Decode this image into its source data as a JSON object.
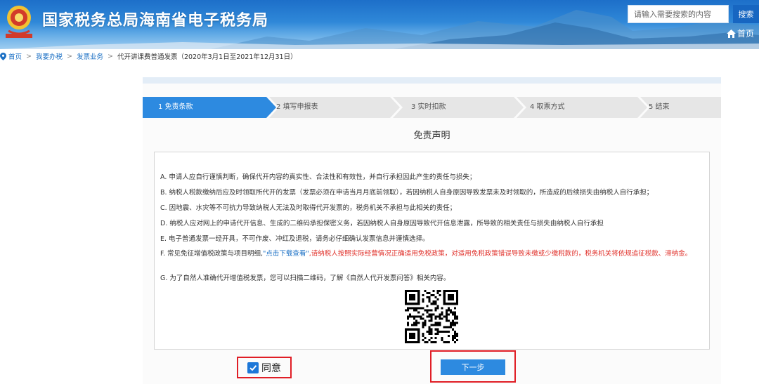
{
  "header": {
    "title": "国家税务总局海南省电子税务局",
    "search_placeholder": "请输入需要搜索的内容",
    "search_button": "搜索",
    "home_label": "首页"
  },
  "breadcrumb": {
    "items": [
      "首页",
      "我要办税",
      "发票业务",
      "代开讲课费普通发票（2020年3月1日至2021年12月31日）"
    ],
    "separator": ">"
  },
  "steps": [
    {
      "label": "1  免责条款",
      "active": true
    },
    {
      "label": "2  填写申报表",
      "active": false
    },
    {
      "label": "3  实时扣款",
      "active": false
    },
    {
      "label": "4  取票方式",
      "active": false
    },
    {
      "label": "5  结束",
      "active": false
    }
  ],
  "notice": {
    "title": "免责声明",
    "terms": {
      "a": "A. 申请人应自行谨慎判断，确保代开内容的真实性、合法性和有效性，并自行承担因此产生的责任与损失；",
      "b": "B. 纳税人税款缴纳后应及时领取所代开的发票（发票必须在申请当月月底前领取），若因纳税人自身原因导致发票未及时领取的，所造成的后续损失由纳税人自行承担；",
      "c": "C. 因地震、水灾等不可抗力导致纳税人无法及时取得代开发票的，税务机关不承担与此相关的责任；",
      "d": "D. 纳税人应对网上的申请代开信息、生成的二维码承担保密义务，若因纳税人自身原因导致代开信息泄露，所导致的相关责任与损失由纳税人自行承担",
      "e": "E. 电子普通发票一经开具，不可作废、冲红及退税，请务必仔细确认发票信息并谨慎选择。",
      "f_prefix": "F. 常见免征增值税政策与项目明细,",
      "f_link": "\"点击下载查看\"",
      "f_rest": ",请纳税人按照实际经营情况正确适用免税政策，对适用免税政策错误导致未缴或少缴税款的，税务机关将依规追征税款、滞纳金。",
      "g": "G. 为了自然人准确代开增值税发票，您可以扫描二维码，了解《自然人代开发票问答》相关内容。"
    }
  },
  "actions": {
    "agree_label": "同意",
    "agree_checked": true,
    "next_label": "下一步"
  },
  "colors": {
    "header_blue": "#1d6fc9",
    "active_step": "#2d8ae0",
    "inactive_step": "#e6e6e6",
    "link_blue": "#1a6fc4",
    "warning_red": "#e0302a",
    "highlight_border": "#e01e26"
  }
}
